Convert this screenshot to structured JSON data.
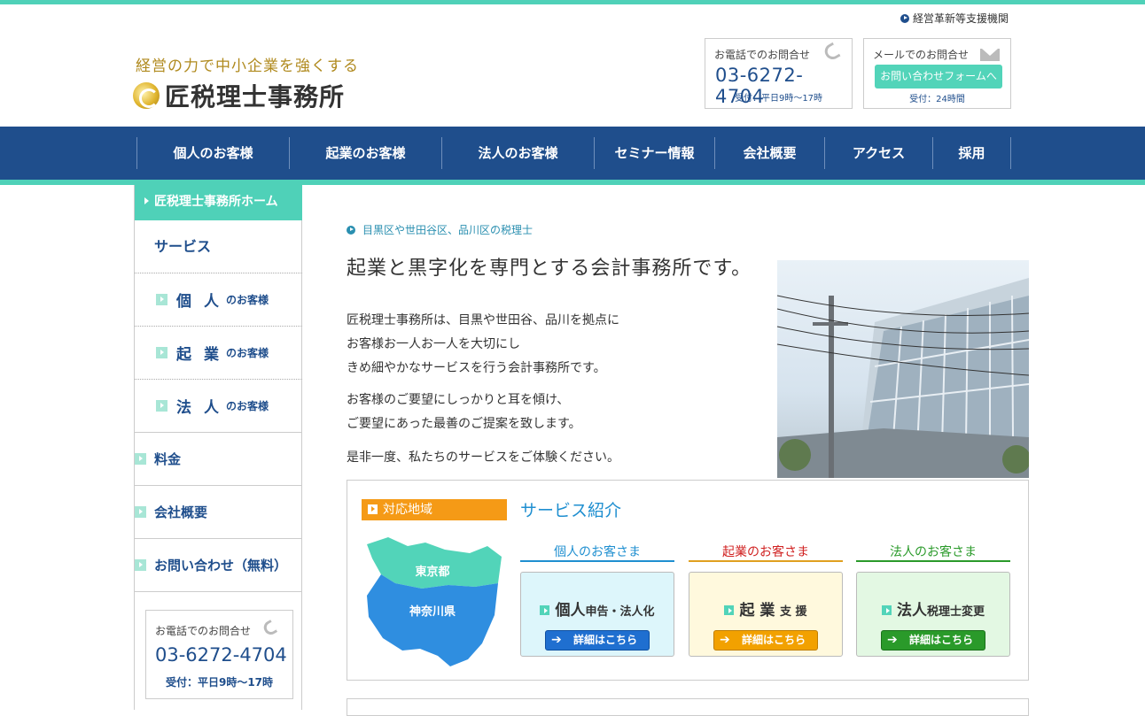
{
  "header": {
    "util_link": "経営革新等支援機関",
    "tagline": "経営の力で中小企業を強くする",
    "logo_text": "匠税理士事務所",
    "phone": {
      "label": "お電話でのお問合せ",
      "number": "03-6272-4704",
      "hours": "受付：平日9時〜17時"
    },
    "mail": {
      "label": "メールでのお問合せ",
      "button": "お問い合わせフォームへ",
      "hours": "受付：24時間"
    }
  },
  "gnav": [
    "個人のお客様",
    "起業のお客様",
    "法人のお客様",
    "セミナー情報",
    "会社概要",
    "アクセス",
    "採用"
  ],
  "sidebar": {
    "home": "匠税理士事務所ホーム",
    "service": "サービス",
    "subs": [
      {
        "big": "個人",
        "small": "のお客様"
      },
      {
        "big": "起業",
        "small": "のお客様"
      },
      {
        "big": "法人",
        "small": "のお客様"
      }
    ],
    "mains": [
      "料金",
      "会社概要",
      "お問い合わせ（無料）"
    ],
    "phone": {
      "label": "お電話でのお問合せ",
      "number": "03-6272-4704",
      "hours": "受付：平日9時〜17時"
    }
  },
  "main": {
    "breadcrumb": "目黒区や世田谷区、品川区の税理士",
    "title": "起業と黒字化を専門とする会計事務所です。",
    "intro": [
      "匠税理士事務所は、目黒や世田谷、品川を拠点に",
      "お客様お一人お一人を大切にし",
      "きめ細やかなサービスを行う会計事務所です。",
      "お客様のご要望にしっかりと耳を傾け、",
      "ご要望にあった最善のご提案を致します。",
      "是非一度、私たちのサービスをご体験ください。"
    ],
    "area": {
      "label": "対応地域",
      "tokyo": "東京都",
      "kanagawa": "神奈川県"
    },
    "service_title": "サービス紹介",
    "services": [
      {
        "head": "個人のお客さま",
        "big": "個人",
        "small": "申告・法人化",
        "button": "詳細はこちら",
        "color": "#1f8fd0"
      },
      {
        "head": "起業のお客さま",
        "big": "起 業",
        "small": "支 援",
        "button": "詳細はこちら",
        "color": "#d02020"
      },
      {
        "head": "法人のお客さま",
        "big": "法人",
        "small": "税理士変更",
        "button": "詳細はこちら",
        "color": "#2a9a2a"
      }
    ]
  },
  "colors": {
    "accent": "#4fd1b8",
    "navy": "#1f4e8c",
    "orange": "#f59a16"
  }
}
